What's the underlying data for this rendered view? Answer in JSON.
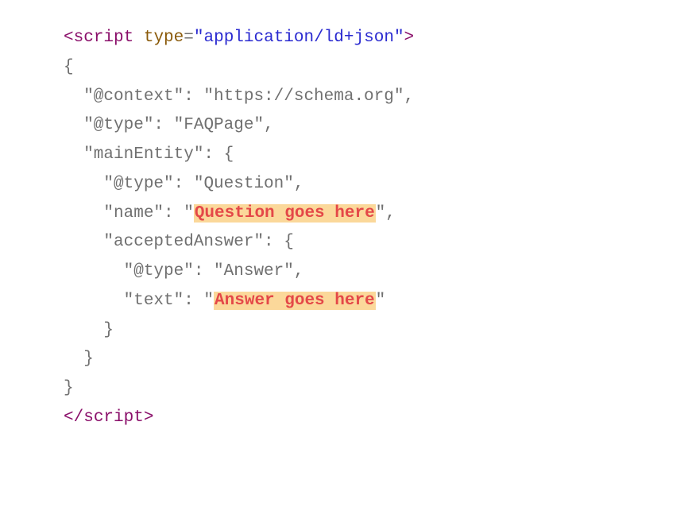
{
  "code": {
    "open_tag_lt": "<",
    "open_tag_name": "script",
    "attr_name": "type",
    "attr_eq": "=",
    "attr_q1": "\"",
    "attr_value": "application/ld+json",
    "attr_q2": "\"",
    "open_tag_gt": ">",
    "l2": "{",
    "l3_pre": "  \"@context\": \"",
    "l3_val": "https://schema.org",
    "l3_post": "\",",
    "l4_pre": "  \"@type\": \"",
    "l4_val": "FAQPage",
    "l4_post": "\",",
    "l5": "  \"mainEntity\": {",
    "l6_pre": "    \"@type\": \"",
    "l6_val": "Question",
    "l6_post": "\",",
    "l7_pre": "    \"name\": \"",
    "l7_hl": "Question goes here",
    "l7_post": "\",",
    "l8": "    \"acceptedAnswer\": {",
    "l9_pre": "      \"@type\": \"",
    "l9_val": "Answer",
    "l9_post": "\",",
    "l10_pre": "      \"text\": \"",
    "l10_hl": "Answer goes here",
    "l10_post": "\"",
    "l11": "    }",
    "l12": "  }",
    "l13": "}",
    "close_tag_lt": "</",
    "close_tag_name": "script",
    "close_tag_gt": ">"
  }
}
